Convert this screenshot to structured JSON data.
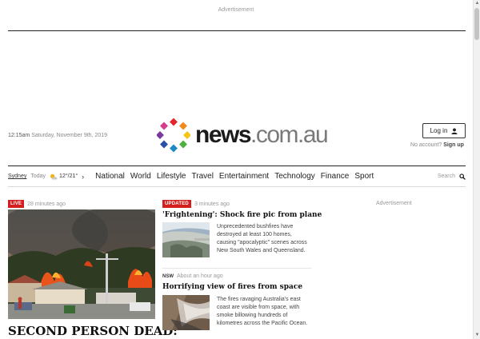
{
  "advertisement_top": "Advertisement",
  "header": {
    "time": "12:15am",
    "date": "Saturday, November 9th, 2019",
    "logo_main": "news",
    "logo_domain": ".com.au",
    "login_label": "Log in",
    "no_account": "No account?",
    "signup": "Sign up"
  },
  "weather": {
    "city": "Sydney",
    "day": "Today",
    "temps": "12°/21°"
  },
  "nav": {
    "items": [
      "National",
      "World",
      "Lifestyle",
      "Travel",
      "Entertainment",
      "Technology",
      "Finance",
      "Sport"
    ],
    "search_label": "Search"
  },
  "lead": {
    "badge": "LIVE",
    "time": "28 minutes ago",
    "headline": "SECOND PERSON DEAD:"
  },
  "stories": [
    {
      "badge": "UPDATED",
      "time": "3 minutes ago",
      "title": "'Frightening': Shock fire pic from plane",
      "summary": "Unprecedented bushfires have destroyed at least 100 homes, causing \"apocalyptic\" scenes across New South Wales and Queensland."
    },
    {
      "badge": "NSW",
      "time": "About an hour ago",
      "title": "Horrifying view of fires from space",
      "summary": "The fires ravaging Australia's east coast are visible from space, with smoke billowing hundreds of kilometres across the Pacific Ocean."
    }
  ],
  "advertisement_right": "Advertisement",
  "colors": {
    "badge_red": "#d41e1e",
    "logo_domain_gray": "#7a7a7a",
    "text_dark": "#222222"
  }
}
